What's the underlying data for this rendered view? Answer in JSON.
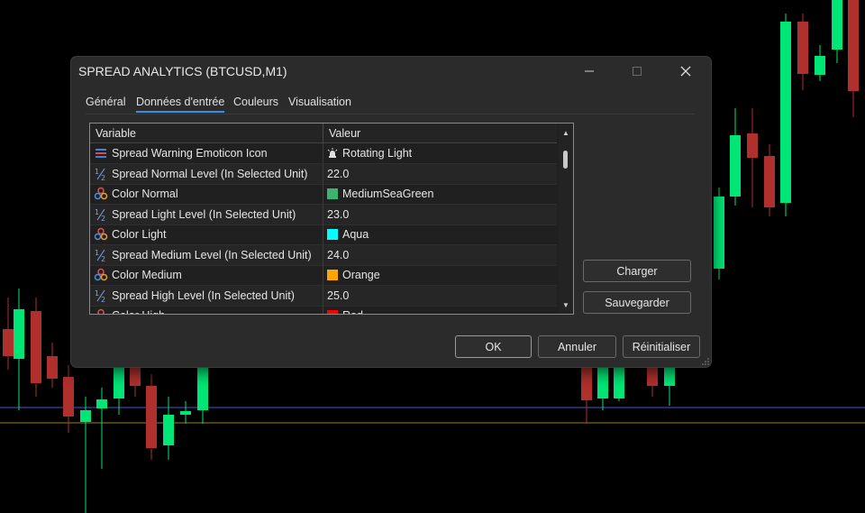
{
  "window": {
    "title": "SPREAD ANALYTICS (BTCUSD,M1)"
  },
  "tabs": [
    {
      "label": "Général",
      "active": false
    },
    {
      "label": "Données d'entrée",
      "active": true
    },
    {
      "label": "Couleurs",
      "active": false
    },
    {
      "label": "Visualisation",
      "active": false
    }
  ],
  "grid": {
    "columns": {
      "variable": "Variable",
      "value": "Valeur"
    },
    "rows": [
      {
        "icon": "lines-icon",
        "variable": "Spread Warning Emoticon Icon",
        "value": "Rotating Light",
        "value_icon": "rotating-light-icon"
      },
      {
        "icon": "half-icon",
        "variable": "Spread Normal Level (In Selected Unit)",
        "value": "22.0"
      },
      {
        "icon": "palette-icon",
        "variable": "Color Normal",
        "value": "MediumSeaGreen",
        "swatch": "#3cb371"
      },
      {
        "icon": "half-icon",
        "variable": "Spread Light Level (In Selected Unit)",
        "value": "23.0"
      },
      {
        "icon": "palette-icon",
        "variable": "Color Light",
        "value": "Aqua",
        "swatch": "#00ffff"
      },
      {
        "icon": "half-icon",
        "variable": "Spread Medium Level (In Selected Unit)",
        "value": "24.0"
      },
      {
        "icon": "palette-icon",
        "variable": "Color Medium",
        "value": "Orange",
        "swatch": "#ffa500"
      },
      {
        "icon": "half-icon",
        "variable": "Spread High Level (In Selected Unit)",
        "value": "25.0"
      },
      {
        "icon": "palette-icon",
        "variable": "Color High",
        "value": "Red",
        "swatch": "#ff0000"
      }
    ]
  },
  "side_buttons": {
    "load": "Charger",
    "save": "Sauvegarder"
  },
  "footer": {
    "ok": "OK",
    "cancel": "Annuler",
    "reset": "Réinitialiser"
  },
  "colors": {
    "bull": "#00e676",
    "bear": "#b0302e",
    "accent": "#3b8fe0"
  }
}
